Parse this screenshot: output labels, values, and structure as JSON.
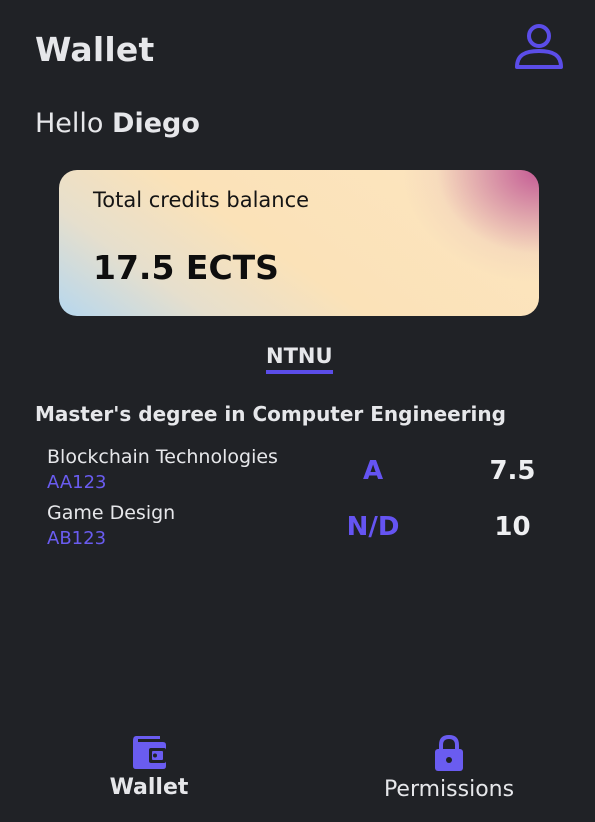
{
  "header": {
    "title": "Wallet",
    "profile_icon": "user-icon"
  },
  "greeting": {
    "prefix": "Hello",
    "name": "Diego"
  },
  "balance": {
    "label": "Total credits balance",
    "value": "17.5 ECTS"
  },
  "tabs": [
    {
      "label": "NTNU",
      "active": true
    }
  ],
  "degree": {
    "title": "Master's degree in Computer Engineering",
    "courses": [
      {
        "name": "Blockchain Technologies",
        "code": "AA123",
        "grade": "A",
        "credits": "7.5"
      },
      {
        "name": "Game Design",
        "code": "AB123",
        "grade": "N/D",
        "credits": "10"
      }
    ]
  },
  "bottom_nav": {
    "items": [
      {
        "label": "Wallet",
        "icon": "wallet-icon",
        "active": true
      },
      {
        "label": "Permissions",
        "icon": "lock-icon",
        "active": false
      }
    ]
  },
  "colors": {
    "background": "#202226",
    "accent": "#5b4de8",
    "text": "#e6e7ea"
  }
}
